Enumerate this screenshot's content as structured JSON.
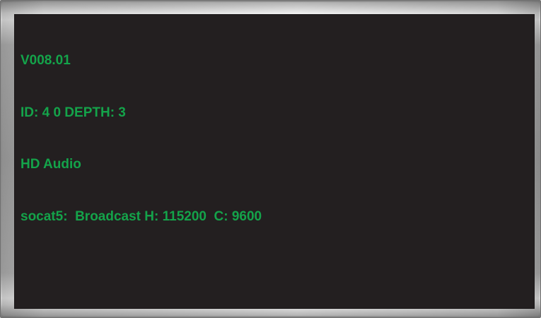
{
  "theme": {
    "screen_background": "#231f20",
    "text_color": "#14a34a",
    "bezel_color": "#a7a7a7"
  },
  "terminal": {
    "lines": [
      "V008.01",
      "ID: 4 0 DEPTH: 3",
      "HD Audio",
      "socat5:  Broadcast H: 115200  C: 9600"
    ]
  }
}
